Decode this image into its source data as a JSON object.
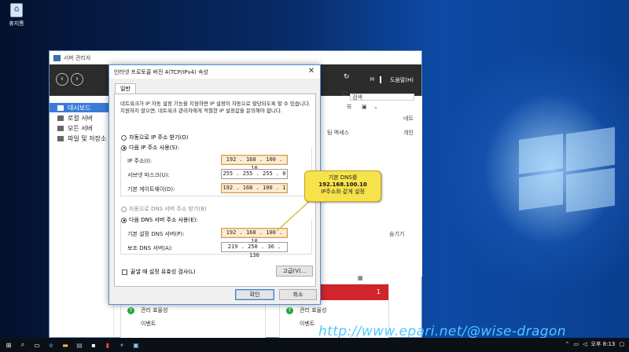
{
  "desktop": {
    "recycle_bin_label": "휴지통"
  },
  "server_manager": {
    "title": "서버 관리자",
    "menu": [
      "H",
      "도움말(H)"
    ],
    "sidebar_items": [
      {
        "label": "대시보드",
        "active": true
      },
      {
        "label": "로컬 서버",
        "active": false
      },
      {
        "label": "모든 서버",
        "active": false
      },
      {
        "label": "파일 및 저장소",
        "active": false
      }
    ],
    "right_panel": {
      "search": "검색",
      "col_network": "네트",
      "col_access": "팀 액세스",
      "col_personal": "개인",
      "link": "숨기기"
    },
    "tiles": {
      "left_rows": [
        "관리 효율성",
        "이벤트"
      ],
      "right_header_suffix": "ㅣ",
      "right_count": "1",
      "right_rows": [
        "관리 효율성",
        "이벤트"
      ]
    }
  },
  "dialog": {
    "title": "인터넷 프로토콜 버전 4(TCP/IPv4) 속성",
    "tab": "일반",
    "description": "네트워크가 IP 자동 설정 기능을 지원하면 IP 설정이 자동으로 할당되도록 할 수 있습니다. 지원하지 않으면, 네트워크 관리자에게 적절한 IP 설정값을 문의해야 합니다.",
    "radio_auto_ip": "자동으로 IP 주소 받기(O)",
    "radio_manual_ip": "다음 IP 주소 사용(S):",
    "ip_label": "IP 주소(I):",
    "ip_value": "192 . 168 . 100 . 10",
    "subnet_label": "서브넷 마스크(U):",
    "subnet_value": "255 . 255 . 255 .  0",
    "gateway_label": "기본 게이트웨이(D):",
    "gateway_value": "192 . 168 . 100 . 1",
    "radio_auto_dns": "자동으로 DNS 서버 주소 받기(B)",
    "radio_manual_dns": "다음 DNS 서버 주소 사용(E):",
    "dns1_label": "기본 설정 DNS 서버(P):",
    "dns1_value": "192 . 168 . 100 . 10",
    "dns2_label": "보조 DNS 서버(A):",
    "dns2_value": "219 . 250 .  36 . 130",
    "checkbox_label": "끝낼 때 설정 유효성 검사(L)",
    "advanced_button": "고급(V)...",
    "ok_button": "확인",
    "cancel_button": "취소"
  },
  "callout": {
    "line1": "기본 DNS를",
    "line2": "192.168.100.10",
    "line3": "IP주소와 같게 설정"
  },
  "watermark": "http://www.epari.net/@wise-dragon",
  "taskbar": {
    "time": "오후 8:13"
  },
  "colors": {
    "accent": "#3b7bd8",
    "callout": "#f6e24a",
    "alert": "#d1242d",
    "watermark": "#4fc7ff"
  }
}
